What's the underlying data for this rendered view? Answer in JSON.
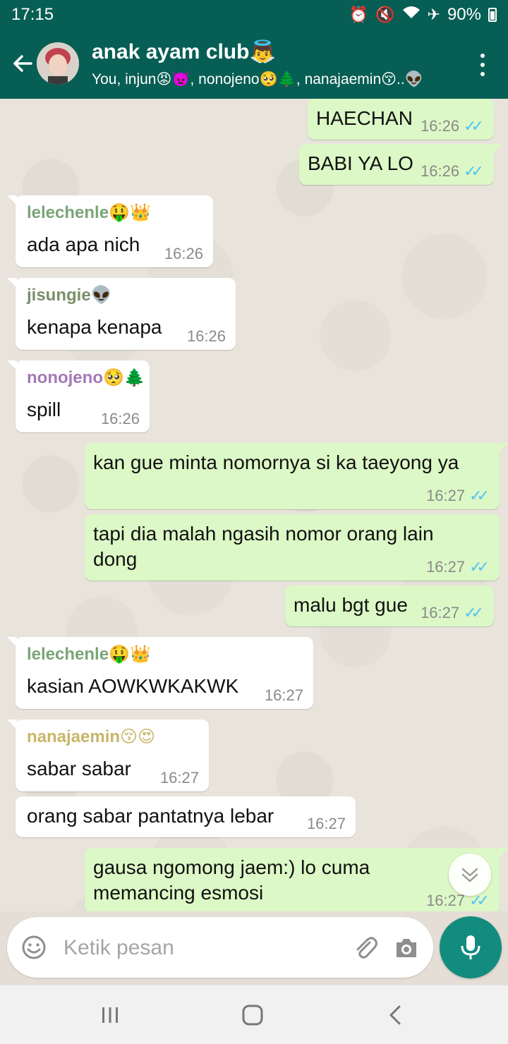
{
  "status_bar": {
    "time": "17:15",
    "battery": "90%",
    "icons": [
      "alarm-icon",
      "mute-icon",
      "wifi-icon",
      "airplane-icon",
      "battery-icon"
    ]
  },
  "header": {
    "title": "anak ayam club👼",
    "subtitle": "You, injun😡👿, nonojeno🥺🌲, nanajaemin😚..👽"
  },
  "messages": [
    {
      "dir": "out",
      "text": "HAECHAN",
      "time": "16:26",
      "read": true
    },
    {
      "dir": "out",
      "text": "BABI YA LO",
      "time": "16:26",
      "read": true
    },
    {
      "dir": "in",
      "sender": "lelechenle🤑👑",
      "sender_color": "#7aa577",
      "text": "ada apa nich",
      "time": "16:26"
    },
    {
      "dir": "in",
      "sender": "jisungie👽",
      "sender_color": "#7a8f6a",
      "text": "kenapa kenapa",
      "time": "16:26"
    },
    {
      "dir": "in",
      "sender": "nonojeno🥺🌲",
      "sender_color": "#a578b5",
      "text": "spill",
      "time": "16:26"
    },
    {
      "dir": "out",
      "text": "kan gue minta nomornya si ka taeyong ya",
      "time": "16:27",
      "read": true
    },
    {
      "dir": "out",
      "text": "tapi dia malah ngasih nomor orang lain dong",
      "time": "16:27",
      "read": true
    },
    {
      "dir": "out",
      "text": "malu bgt gue",
      "time": "16:27",
      "read": true
    },
    {
      "dir": "in",
      "sender": "lelechenle🤑👑",
      "sender_color": "#7aa577",
      "text": "kasian AOWKWKAKWK",
      "time": "16:27"
    },
    {
      "dir": "in",
      "sender": "nanajaemin😚😍",
      "sender_color": "#c9b66a",
      "text": "sabar sabar",
      "time": "16:27"
    },
    {
      "dir": "in",
      "text": "orang sabar pantatnya lebar",
      "time": "16:27"
    },
    {
      "dir": "out",
      "text": "gausa ngomong jaem:) lo cuma memancing esmosi",
      "time": "16:27",
      "read": true
    }
  ],
  "input": {
    "placeholder": "Ketik pesan"
  },
  "colors": {
    "header": "#075e54",
    "outgoing_bubble": "#dcf8c6",
    "incoming_bubble": "#ffffff",
    "read_ticks": "#4fc3f7",
    "mic_button": "#128c7e"
  }
}
